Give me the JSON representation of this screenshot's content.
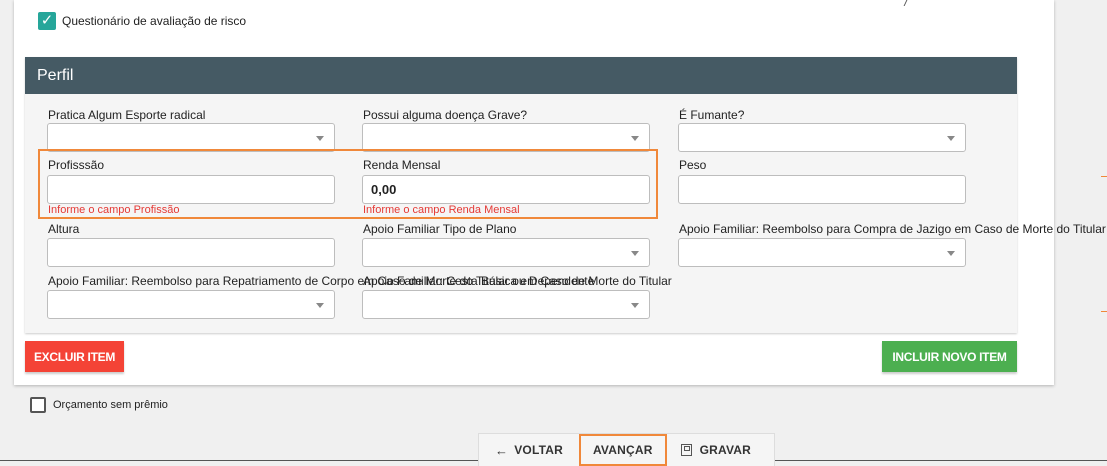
{
  "top_checkbox": {
    "label": "Questionário de avaliação de risco",
    "checked": true
  },
  "panel": {
    "title": "Perfil",
    "fields": {
      "esporte": {
        "label": "Pratica Algum Esporte radical"
      },
      "doenca": {
        "label": "Possui alguma doença Grave?"
      },
      "fumante": {
        "label": "É Fumante?"
      },
      "profissao": {
        "label": "Profisssão",
        "value": "",
        "error": "Informe o campo Profissão"
      },
      "renda": {
        "label": "Renda Mensal",
        "value": "0,00",
        "error": "Informe o campo Renda Mensal"
      },
      "peso": {
        "label": "Peso",
        "value": ""
      },
      "altura": {
        "label": "Altura",
        "value": ""
      },
      "apoio_tipo": {
        "label": "Apoio Familiar Tipo de Plano"
      },
      "apoio_jazigo": {
        "label": "Apoio Familiar: Reembolso para Compra de Jazigo em Caso de Morte do Titular ou"
      },
      "apoio_repatriamento": {
        "label": "Apoio Familiar: Reembolso para Repatriamento de Corpo em Caso de Morte do Titular ou Dependente"
      },
      "apoio_cesta": {
        "label": "Apoio Familiar: Cesta Básica em Caso de Morte do Titular"
      }
    },
    "delete_button": "EXCLUIR ITEM",
    "add_button": "INCLUIR NOVO ITEM"
  },
  "bottom_checkbox": {
    "label": "Orçamento sem prêmio",
    "checked": false
  },
  "footer": {
    "back": "VOLTAR",
    "next": "AVANÇAR",
    "save": "GRAVAR"
  },
  "colors": {
    "header": "#455a64",
    "delete": "#f44336",
    "add": "#4caf50",
    "error": "#e53935",
    "check": "#26a69a",
    "highlight": "#f0883a"
  }
}
